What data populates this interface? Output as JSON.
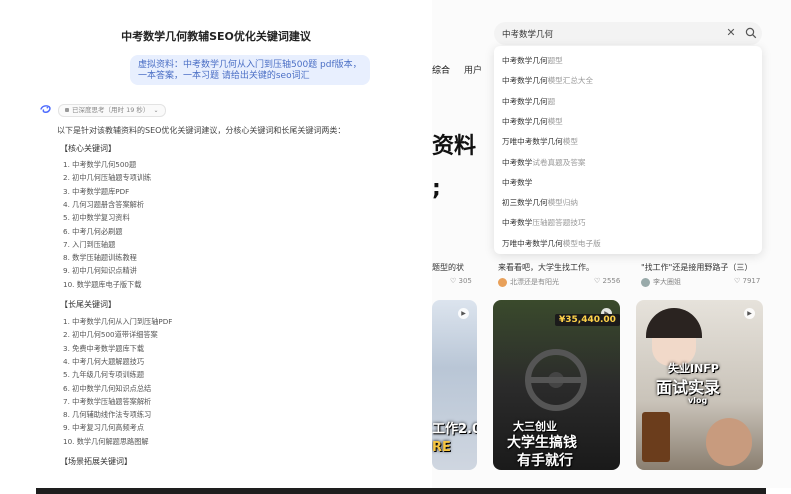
{
  "chat": {
    "title": "中考数学几何教辅SEO优化关键词建议",
    "user_message": "虚拟资料：中考数学几何从入门到压轴500题 pdf版本，一本答案，一本习题 请给出关键的seo词汇",
    "model_label": "已深度思考（用时 19 秒）",
    "intro": "以下是针对该教辅资料的SEO优化关键词建议，分核心关键词和长尾关键词两类：",
    "section_core": "【核心关键词】",
    "core_keywords": [
      "1. 中考数学几何500题",
      "2. 初中几何压轴题专项训练",
      "3. 中考数学题库PDF",
      "4. 几何习题册含答案解析",
      "5. 初中数学复习资料",
      "6. 中考几何必刷题",
      "7. 入门到压轴题",
      "8. 数学压轴题训练教程",
      "9. 初中几何知识点精讲",
      "10. 数学题库电子版下载"
    ],
    "section_long": "【长尾关键词】",
    "long_keywords": [
      "1. 中考数学几何从入门到压轴PDF",
      "2. 初中几何500道带详细答案",
      "3. 免费中考数学题库下载",
      "4. 中考几何大题解题技巧",
      "5. 九年级几何专项训练题",
      "6. 初中数学几何知识点总结",
      "7. 中考数学压轴题答案解析",
      "8. 几何辅助线作法专项练习",
      "9. 中考复习几何高频考点",
      "10. 数学几何解题思路图解"
    ],
    "section_scene": "【场景拓展关键词】"
  },
  "right": {
    "tabs": [
      "综合",
      "用户"
    ],
    "big_text": "资料",
    "semicolon": ";",
    "cards": [
      {
        "title": "题型的状",
        "author": "",
        "likes": "305"
      },
      {
        "title": "来看看吧，大学生找工作。",
        "author": "北漂还是有阳光",
        "likes": "2556"
      },
      {
        "title": "\"找工作\"还是接用野路子（三）",
        "author": "李大圈姐",
        "likes": "7917"
      }
    ],
    "thumbs": [
      {
        "overlay": "工作2.0",
        "overlay2": "RE"
      },
      {
        "price": "¥35,440.00",
        "overlay": "大三创业",
        "overlay2": "大学生搞钱",
        "overlay3": "有手就行"
      },
      {
        "overlay": "失业INFP",
        "overlay2": "面试实录",
        "overlay3": "vlog"
      }
    ]
  },
  "search": {
    "value": "中考数学几何",
    "suggestions": [
      {
        "hl": "中考数学几何",
        "rest": "题型"
      },
      {
        "hl": "中考数学几何",
        "rest": "模型汇总大全"
      },
      {
        "hl": "中考数学几何",
        "rest": "题"
      },
      {
        "hl": "中考数学几何",
        "rest": "模型"
      },
      {
        "hl": "万唯中考数学几何",
        "rest": "模型"
      },
      {
        "hl": "中考数学",
        "rest": "试卷真题及答案"
      },
      {
        "hl": "中考数学",
        "rest": ""
      },
      {
        "hl": "初三数学几何",
        "rest": "模型归纳"
      },
      {
        "hl": "中考数学",
        "rest": "压轴题答题技巧"
      },
      {
        "hl": "万唯中考数学几何",
        "rest": "模型电子版"
      }
    ]
  },
  "colors": {
    "bubble": "#e8effe",
    "bubble_text": "#4b6fc5",
    "accent": "#ff2442"
  }
}
